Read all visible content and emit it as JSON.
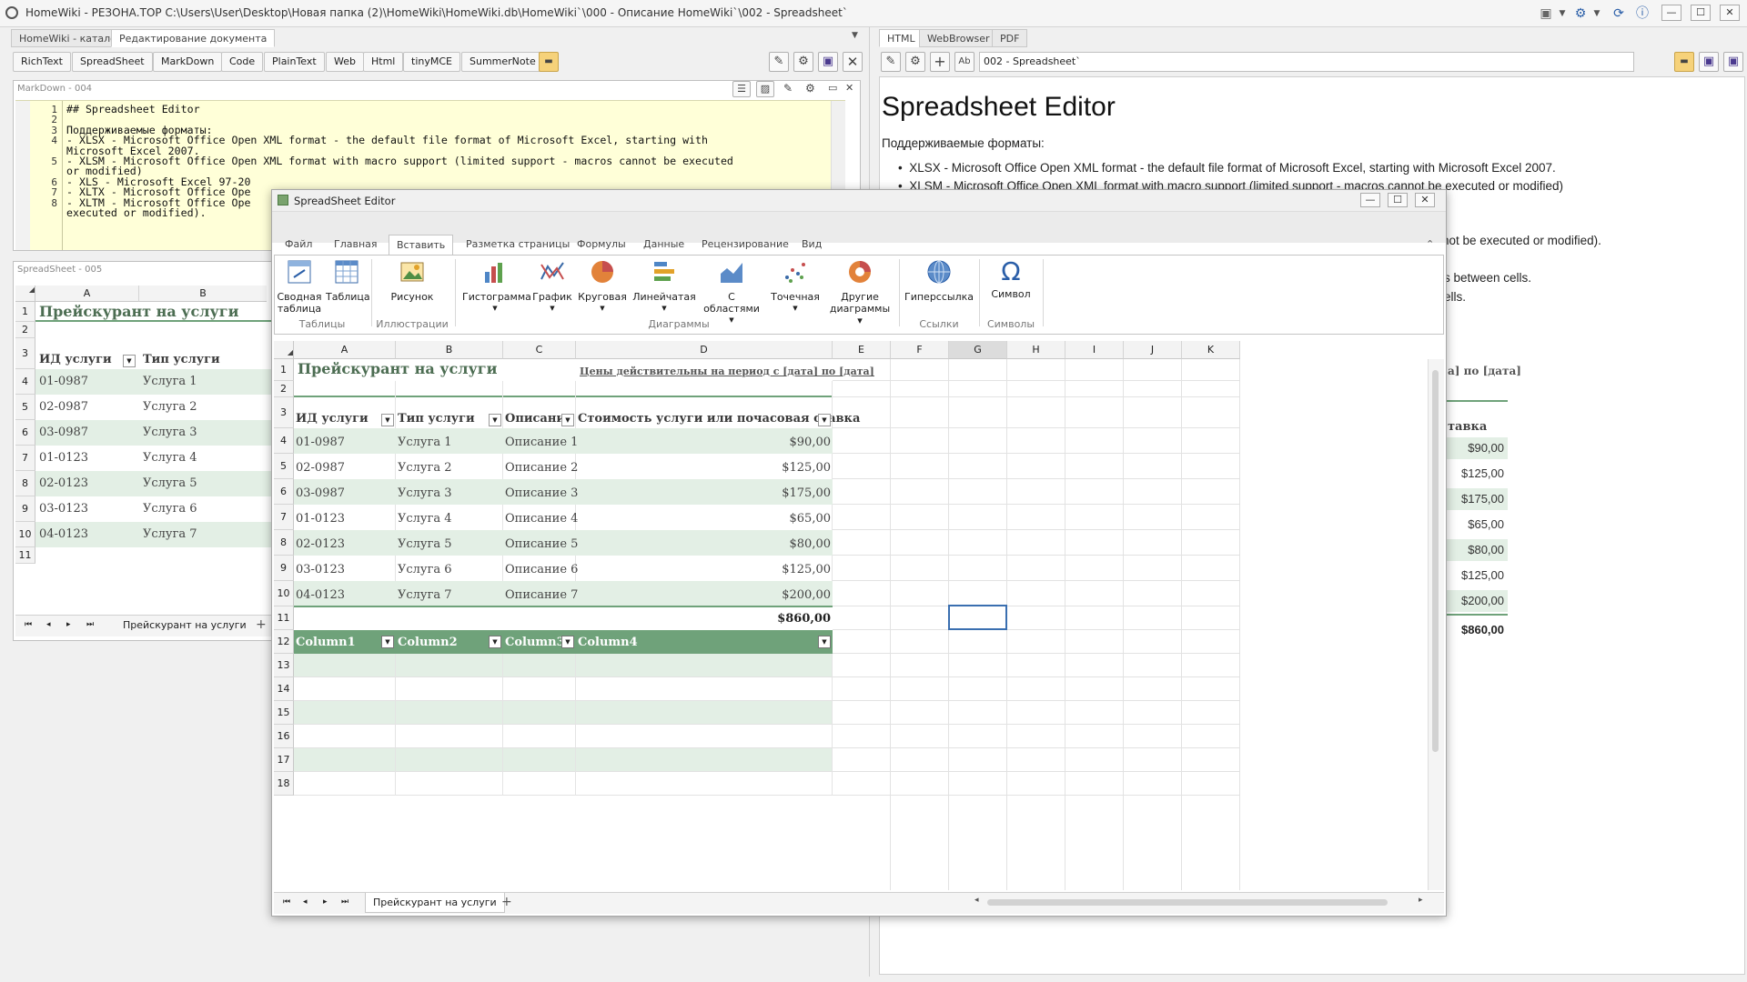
{
  "app": {
    "title": "HomeWiki - РЕЗОНА.ТОР   C:\\Users\\User\\Desktop\\Новая папка (2)\\HomeWiki\\HomeWiki.db\\HomeWiki`\\000 - Описание HomeWiki`\\002 - Spreadsheet`",
    "min": "—",
    "max": "☐",
    "close": "✕"
  },
  "left_tabs": [
    "HomeWiki - каталог",
    "Редактирование документа"
  ],
  "format_buttons": [
    "RichText",
    "SpreadSheet",
    "MarkDown",
    "Code",
    "PlainText",
    "Web",
    "Html",
    "tinyMCE",
    "SummerNote"
  ],
  "markdown": {
    "title": "MarkDown - 004",
    "lines": [
      {
        "n": "1",
        "text": "## Spreadsheet Editor"
      },
      {
        "n": "2",
        "text": ""
      },
      {
        "n": "3",
        "text": "Поддерживаемые форматы:"
      },
      {
        "n": "4",
        "text": "- XLSX - Microsoft Office Open XML format - the default file format of Microsoft Excel, starting with"
      },
      {
        "n": "",
        "text": "Microsoft Excel 2007."
      },
      {
        "n": "5",
        "text": "- XLSM - Microsoft Office Open XML format with macro support (limited support - macros cannot be executed"
      },
      {
        "n": "",
        "text": "or modified)"
      },
      {
        "n": "6",
        "text": "- XLS - Microsoft Excel 97-20"
      },
      {
        "n": "7",
        "text": "- XLTX - Microsoft Office Ope"
      },
      {
        "n": "8",
        "text": "- XLTM - Microsoft Office Ope"
      },
      {
        "n": "",
        "text": "executed or modified)."
      }
    ]
  },
  "small_sheet": {
    "title": "SpreadSheet - 005",
    "col_a": "A",
    "col_b": "B",
    "heading": "Прейскурант на услуги",
    "hdr_id": "ИД услуги",
    "hdr_type": "Тип услуги",
    "rows": [
      {
        "n": "1"
      },
      {
        "n": "2"
      },
      {
        "n": "3"
      },
      {
        "n": "4",
        "id": "01-0987",
        "type": "Услуга 1"
      },
      {
        "n": "5",
        "id": "02-0987",
        "type": "Услуга 2"
      },
      {
        "n": "6",
        "id": "03-0987",
        "type": "Услуга 3"
      },
      {
        "n": "7",
        "id": "01-0123",
        "type": "Услуга 4"
      },
      {
        "n": "8",
        "id": "02-0123",
        "type": "Услуга 5"
      },
      {
        "n": "9",
        "id": "03-0123",
        "type": "Услуга 6"
      },
      {
        "n": "10",
        "id": "04-0123",
        "type": "Услуга 7"
      },
      {
        "n": "11"
      }
    ],
    "sheet_tab": "Прейскурант на услуги"
  },
  "right_tabs": [
    "HTML",
    "WebBrowser",
    "PDF"
  ],
  "preview": {
    "address": "002 - Spreadsheet`",
    "heading": "Spreadsheet Editor",
    "formats_label": "Поддерживаемые форматы:",
    "bullets": [
      "XLSX - Microsoft Office Open XML format - the default file format of Microsoft Excel, starting with Microsoft Excel 2007.",
      "XLSM - Microsoft Office Open XML format with macro support (limited support - macros cannot be executed or modified)"
    ],
    "frag1": "not be executed or modified).",
    "frag2": "s between cells.",
    "frag3": "ells.",
    "frag_date": "a] по [дата]",
    "frag_rate": "тавка",
    "prices": [
      "$90,00",
      "$125,00",
      "$175,00",
      "$65,00",
      "$80,00",
      "$125,00",
      "$200,00"
    ],
    "total": "$860,00"
  },
  "editor": {
    "title": "SpreadSheet Editor",
    "ribbon_tabs": [
      "Файл",
      "Главная",
      "Вставить",
      "Разметка страницы",
      "Формулы",
      "Данные",
      "Рецензирование",
      "Вид"
    ],
    "ribbon_items": [
      {
        "label": "Сводная\nтаблица"
      },
      {
        "label": "Таблица"
      },
      {
        "label": "Рисунок"
      },
      {
        "label": "Гистограмма"
      },
      {
        "label": "График"
      },
      {
        "label": "Круговая"
      },
      {
        "label": "Линейчатая"
      },
      {
        "label": "С областями"
      },
      {
        "label": "Точечная"
      },
      {
        "label": "Другие\nдиаграммы ▾"
      },
      {
        "label": "Гиперссылка"
      },
      {
        "label": "Символ"
      }
    ],
    "groups": [
      "Таблицы",
      "Иллюстрации",
      "Диаграммы",
      "Ссылки",
      "Символы"
    ],
    "columns": [
      "A",
      "B",
      "C",
      "D",
      "E",
      "F",
      "G",
      "H",
      "I",
      "J",
      "K"
    ],
    "row_numbers": [
      "1",
      "2",
      "3",
      "4",
      "5",
      "6",
      "7",
      "8",
      "9",
      "10",
      "11",
      "12",
      "13",
      "14",
      "15",
      "16",
      "17",
      "18"
    ],
    "title_cell": "Прейскурант на услуги",
    "date_cell": "Цены действительны на период с [дата] по [дата]",
    "headers": [
      "ИД услуги",
      "Тип услуги",
      "Описание",
      "Стоимость услуги или почасовая ставка"
    ],
    "rows": [
      {
        "id": "01-0987",
        "type": "Услуга 1",
        "desc": "Описание 1",
        "price": "$90,00"
      },
      {
        "id": "02-0987",
        "type": "Услуга 2",
        "desc": "Описание 2",
        "price": "$125,00"
      },
      {
        "id": "03-0987",
        "type": "Услуга 3",
        "desc": "Описание 3",
        "price": "$175,00"
      },
      {
        "id": "01-0123",
        "type": "Услуга 4",
        "desc": "Описание 4",
        "price": "$65,00"
      },
      {
        "id": "02-0123",
        "type": "Услуга 5",
        "desc": "Описание 5",
        "price": "$80,00"
      },
      {
        "id": "03-0123",
        "type": "Услуга 6",
        "desc": "Описание 6",
        "price": "$125,00"
      },
      {
        "id": "04-0123",
        "type": "Услуга 7",
        "desc": "Описание 7",
        "price": "$200,00"
      }
    ],
    "total": "$860,00",
    "table2_headers": [
      "Column1",
      "Column2",
      "Column3",
      "Column4"
    ],
    "sheet_tab": "Прейскурант на услуги"
  },
  "colors": {
    "accent_green": "#6fa27a",
    "band_green": "#e3efe5",
    "yellow_editor": "#ffffd8"
  }
}
